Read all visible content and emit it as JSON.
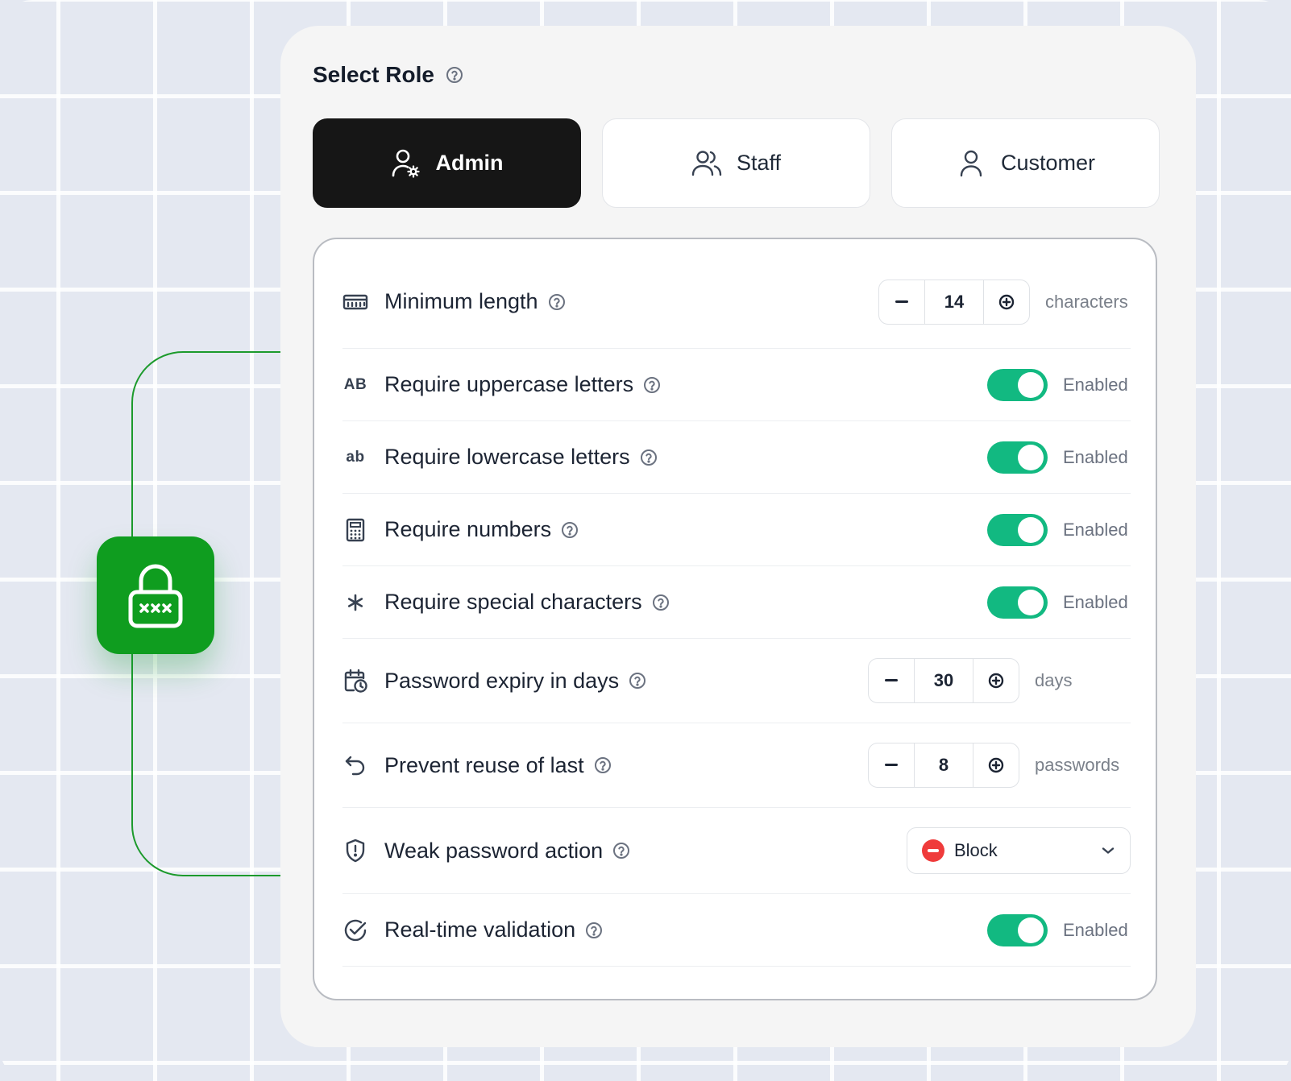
{
  "panel": {
    "title": "Select Role"
  },
  "roles": [
    {
      "label": "Admin",
      "icon": "user-gear-icon",
      "active": true
    },
    {
      "label": "Staff",
      "icon": "users-icon",
      "active": false
    },
    {
      "label": "Customer",
      "icon": "user-icon",
      "active": false
    }
  ],
  "settings": {
    "min_length": {
      "label": "Minimum length",
      "icon": "ruler-icon",
      "value": "14",
      "unit": "characters"
    },
    "uppercase": {
      "label": "Require uppercase letters",
      "icon_text": "AB",
      "state": "Enabled",
      "enabled": true
    },
    "lowercase": {
      "label": "Require lowercase letters",
      "icon_text": "ab",
      "state": "Enabled",
      "enabled": true
    },
    "numbers": {
      "label": "Require numbers",
      "icon": "calculator-icon",
      "state": "Enabled",
      "enabled": true
    },
    "special": {
      "label": "Require special characters",
      "icon_text": "∗",
      "state": "Enabled",
      "enabled": true
    },
    "expiry": {
      "label": "Password expiry in days",
      "icon": "calendar-clock-icon",
      "value": "30",
      "unit": "days"
    },
    "reuse": {
      "label": "Prevent reuse of last",
      "icon": "undo-icon",
      "value": "8",
      "unit": "passwords"
    },
    "weak_action": {
      "label": "Weak password action",
      "icon": "shield-alert-icon",
      "value": "Block"
    },
    "realtime": {
      "label": "Real-time validation",
      "icon": "check-circle-icon",
      "state": "Enabled",
      "enabled": true
    }
  },
  "colors": {
    "accent_green": "#12b981",
    "lock_green": "#0f9d1f",
    "active_role_bg": "#161616",
    "block_red": "#ef3b3b"
  }
}
